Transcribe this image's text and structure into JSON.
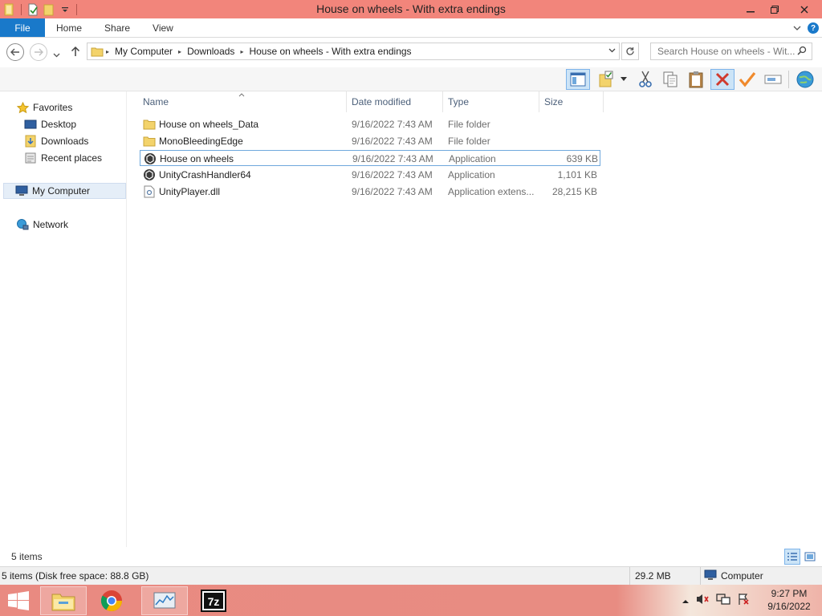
{
  "window": {
    "title": "House on wheels - With extra endings"
  },
  "ribbon": {
    "tabs": [
      "File",
      "Home",
      "Share",
      "View"
    ]
  },
  "address": {
    "crumbs": [
      "My Computer",
      "Downloads",
      "House on wheels - With extra endings"
    ]
  },
  "search": {
    "placeholder": "Search House on wheels - Wit..."
  },
  "navpane": {
    "favorites_label": "Favorites",
    "favorites": [
      "Desktop",
      "Downloads",
      "Recent places"
    ],
    "computer_label": "My Computer",
    "network_label": "Network"
  },
  "columns": {
    "name": "Name",
    "date": "Date modified",
    "type": "Type",
    "size": "Size"
  },
  "files": [
    {
      "name": "House on wheels_Data",
      "date": "9/16/2022 7:43 AM",
      "type": "File folder",
      "size": "",
      "icon": "folder-icon"
    },
    {
      "name": "MonoBleedingEdge",
      "date": "9/16/2022 7:43 AM",
      "type": "File folder",
      "size": "",
      "icon": "folder-icon"
    },
    {
      "name": "House on wheels",
      "date": "9/16/2022 7:43 AM",
      "type": "Application",
      "size": "639 KB",
      "icon": "unity-app-icon"
    },
    {
      "name": "UnityCrashHandler64",
      "date": "9/16/2022 7:43 AM",
      "type": "Application",
      "size": "1,101 KB",
      "icon": "unity-app-icon"
    },
    {
      "name": "UnityPlayer.dll",
      "date": "9/16/2022 7:43 AM",
      "type": "Application extens...",
      "size": "28,215 KB",
      "icon": "dll-file-icon"
    }
  ],
  "status": {
    "items_count": "5 items",
    "disk_info": "5 items (Disk free space: 88.8 GB)",
    "selection_size": "29.2 MB",
    "location": "Computer"
  },
  "clock": {
    "time": "9:27 PM",
    "date": "9/16/2022"
  },
  "taskbar": {
    "sevenzip_label": "7z"
  },
  "colors": {
    "titlebar": "#f2857b",
    "accent": "#1979ca",
    "selection": "#cce4f7"
  }
}
